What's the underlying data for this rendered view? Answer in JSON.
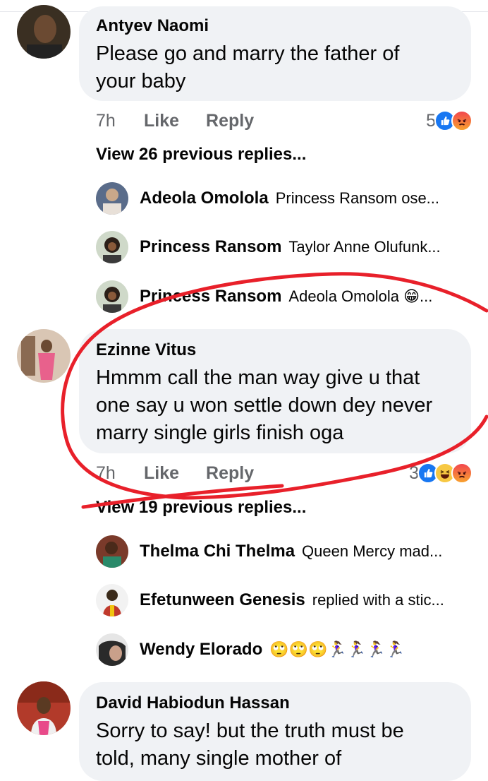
{
  "comments": [
    {
      "author": "Antyev Naomi",
      "text_line1": "Please go and marry the father of",
      "text_line2": "your baby",
      "time": "7h",
      "like": "Like",
      "reply": "Reply",
      "reaction_count": "5",
      "reactions": [
        "like-icon",
        "angry-icon"
      ],
      "view_more": "View 26 previous replies...",
      "replies": [
        {
          "name": "Adeola Omolola",
          "text": "Princess Ransom ose..."
        },
        {
          "name": "Princess Ransom",
          "text": "Taylor Anne Olufunk..."
        },
        {
          "name": "Princess Ransom",
          "text": "Adeola Omolola 😁..."
        }
      ]
    },
    {
      "author": "Ezinne Vitus",
      "text_line1": "Hmmm call the man way give u that",
      "text_line2": "one say u won settle down dey never",
      "text_line3": "marry single girls finish oga",
      "time": "7h",
      "like": "Like",
      "reply": "Reply",
      "reaction_count": "3",
      "reactions": [
        "like-icon",
        "haha-icon",
        "angry-icon"
      ],
      "view_more": "View 19 previous replies...",
      "replies": [
        {
          "name": "Thelma Chi Thelma",
          "text": "Queen Mercy mad..."
        },
        {
          "name": "Efetunween Genesis",
          "text": "replied with a stic..."
        },
        {
          "name": "Wendy Elorado",
          "text": "🙄🙄🙄🏃‍♀️🏃‍♀️🏃‍♀️🏃‍♀️"
        }
      ]
    },
    {
      "author": "David Habiodun Hassan",
      "text_line1": "Sorry to say! but the truth must be",
      "text_line2": "told, many single mother of"
    }
  ],
  "colors": {
    "bubble": "#f0f2f5",
    "secondary_text": "#65676b",
    "like_blue": "#1877f2",
    "annotation_red": "#e8202a"
  }
}
